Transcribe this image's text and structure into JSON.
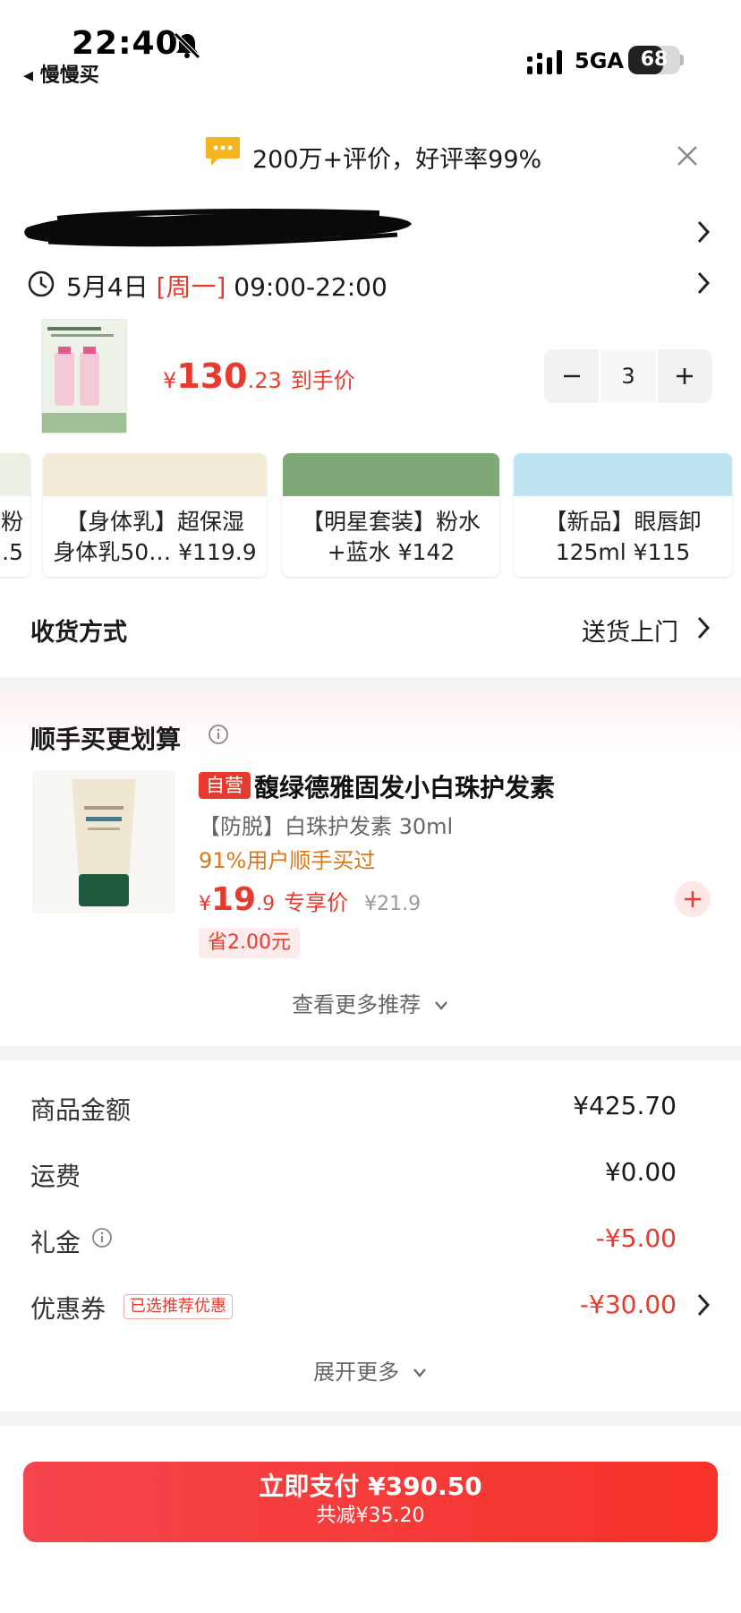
{
  "status_bar": {
    "time": "22:40",
    "back_app": "◂ 慢慢买",
    "network": "5GA",
    "battery": "68",
    "battery_level": 0.68
  },
  "review_banner": {
    "text": "200万+评价，好评率99%"
  },
  "delivery": {
    "date": "5月4日 ",
    "weekday": "[周一]",
    "hours": " 09:00-22:00"
  },
  "product": {
    "price_currency": "¥",
    "price_int": "130",
    "price_dec": ".23",
    "price_tag": "到手价",
    "quantity": "3",
    "minus": "−",
    "plus": "+"
  },
  "recommendations": [
    {
      "text": "粉\n.5"
    },
    {
      "text": "【身体乳】超保湿\n身体乳50… ¥119.9"
    },
    {
      "text": "【明星套装】粉水\n+蓝水 ¥142"
    },
    {
      "text": "【新品】眼唇卸\n125ml ¥115"
    }
  ],
  "shipping": {
    "label": "收货方式",
    "value": "送货上门"
  },
  "addon": {
    "title": "顺手买更划算",
    "badge": "自营",
    "name": "馥绿德雅固发小白珠护发素",
    "spec": "【防脱】白珠护发素 30ml",
    "rate": "91%用户顺手买过",
    "price_currency": "¥",
    "price_int": "19",
    "price_dec": ".9",
    "price_tag": "专享价",
    "orig_price": "¥21.9",
    "save": "省2.00元",
    "more": "查看更多推荐"
  },
  "summary": {
    "goods_label": "商品金额",
    "goods_value": "¥425.70",
    "freight_label": "运费",
    "freight_value": "¥0.00",
    "gift_label": "礼金",
    "gift_value": "-¥5.00",
    "coupon_label": "优惠券",
    "coupon_tag": "已选推荐优惠",
    "coupon_value": "-¥30.00",
    "expand": "展开更多"
  },
  "pay": {
    "label": "立即支付 ¥390.50",
    "sub": "共减¥35.20"
  },
  "colors": {
    "accent": "#e63b2e",
    "orange": "#d9781c"
  }
}
